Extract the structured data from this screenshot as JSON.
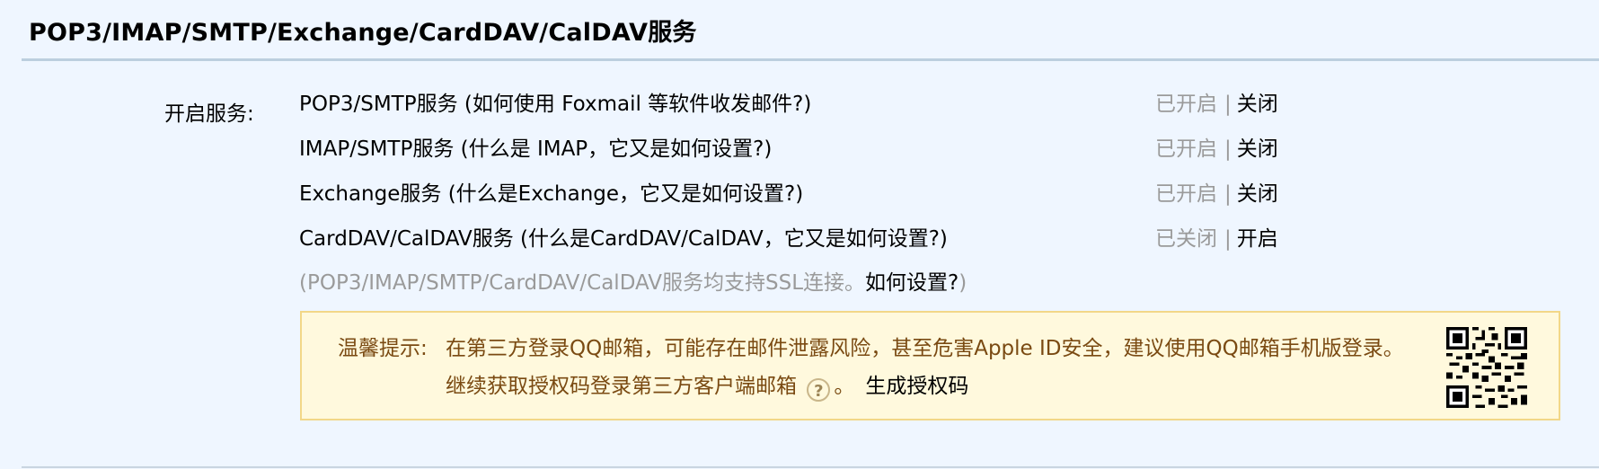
{
  "section": {
    "title": "POP3/IMAP/SMTP/Exchange/CardDAV/CalDAV服务"
  },
  "service_label": "开启服务:",
  "services": [
    {
      "name": "POP3/SMTP服务",
      "help": "(如何使用 Foxmail 等软件收发邮件?)",
      "status": "已开启",
      "separator": "|",
      "action": "关闭"
    },
    {
      "name": "IMAP/SMTP服务",
      "help": "(什么是 IMAP，它又是如何设置?)",
      "status": "已开启",
      "separator": "|",
      "action": "关闭"
    },
    {
      "name": "Exchange服务",
      "help": "(什么是Exchange，它又是如何设置?)",
      "status": "已开启",
      "separator": "|",
      "action": "关闭"
    },
    {
      "name": "CardDAV/CalDAV服务",
      "help": "(什么是CardDAV/CalDAV，它又是如何设置?)",
      "status": "已关闭",
      "separator": "|",
      "action": "开启"
    }
  ],
  "ssl_note": {
    "prefix": "(POP3/IMAP/SMTP/CardDAV/CalDAV服务均支持SSL连接。",
    "link": "如何设置?",
    "suffix": ")"
  },
  "tip": {
    "label": "温馨提示:",
    "line1": "在第三方登录QQ邮箱，可能存在邮件泄露风险，甚至危害Apple ID安全，建议使用QQ邮箱手机版登录。",
    "line2_prefix": "继续获取授权码登录第三方客户端邮箱",
    "help_icon": "question-circle-icon",
    "line2_suffix": "。",
    "generate_link": "生成授权码"
  },
  "colors": {
    "background": "#eff6ff",
    "rule": "#bccfdf",
    "tip_background": "#fff9dd",
    "tip_border": "#f2d788",
    "tip_text": "#7a4a12",
    "muted_text": "#9a9a9a"
  }
}
